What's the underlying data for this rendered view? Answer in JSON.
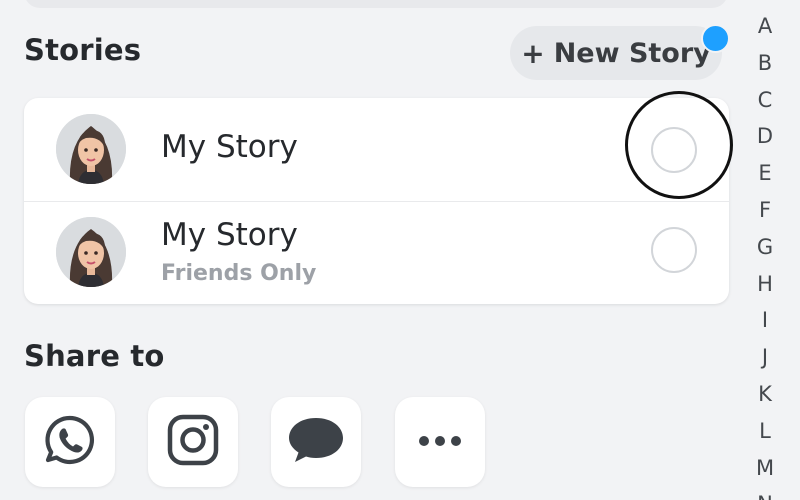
{
  "stories": {
    "title": "Stories",
    "new_story_label": "New Story",
    "new_story_plus": "+",
    "rows": [
      {
        "name": "My Story",
        "subtitle": ""
      },
      {
        "name": "My Story",
        "subtitle": "Friends Only"
      }
    ]
  },
  "share": {
    "title": "Share to",
    "targets": [
      {
        "icon": "whatsapp-icon"
      },
      {
        "icon": "instagram-icon"
      },
      {
        "icon": "messages-icon"
      },
      {
        "icon": "more-options-icon"
      }
    ]
  },
  "alphabet_index": [
    "A",
    "B",
    "C",
    "D",
    "E",
    "F",
    "G",
    "H",
    "I",
    "J",
    "K",
    "L",
    "M",
    "N"
  ],
  "colors": {
    "accent_dot": "#1ea0ff",
    "background": "#f2f3f5",
    "icon": "#3d4248"
  }
}
